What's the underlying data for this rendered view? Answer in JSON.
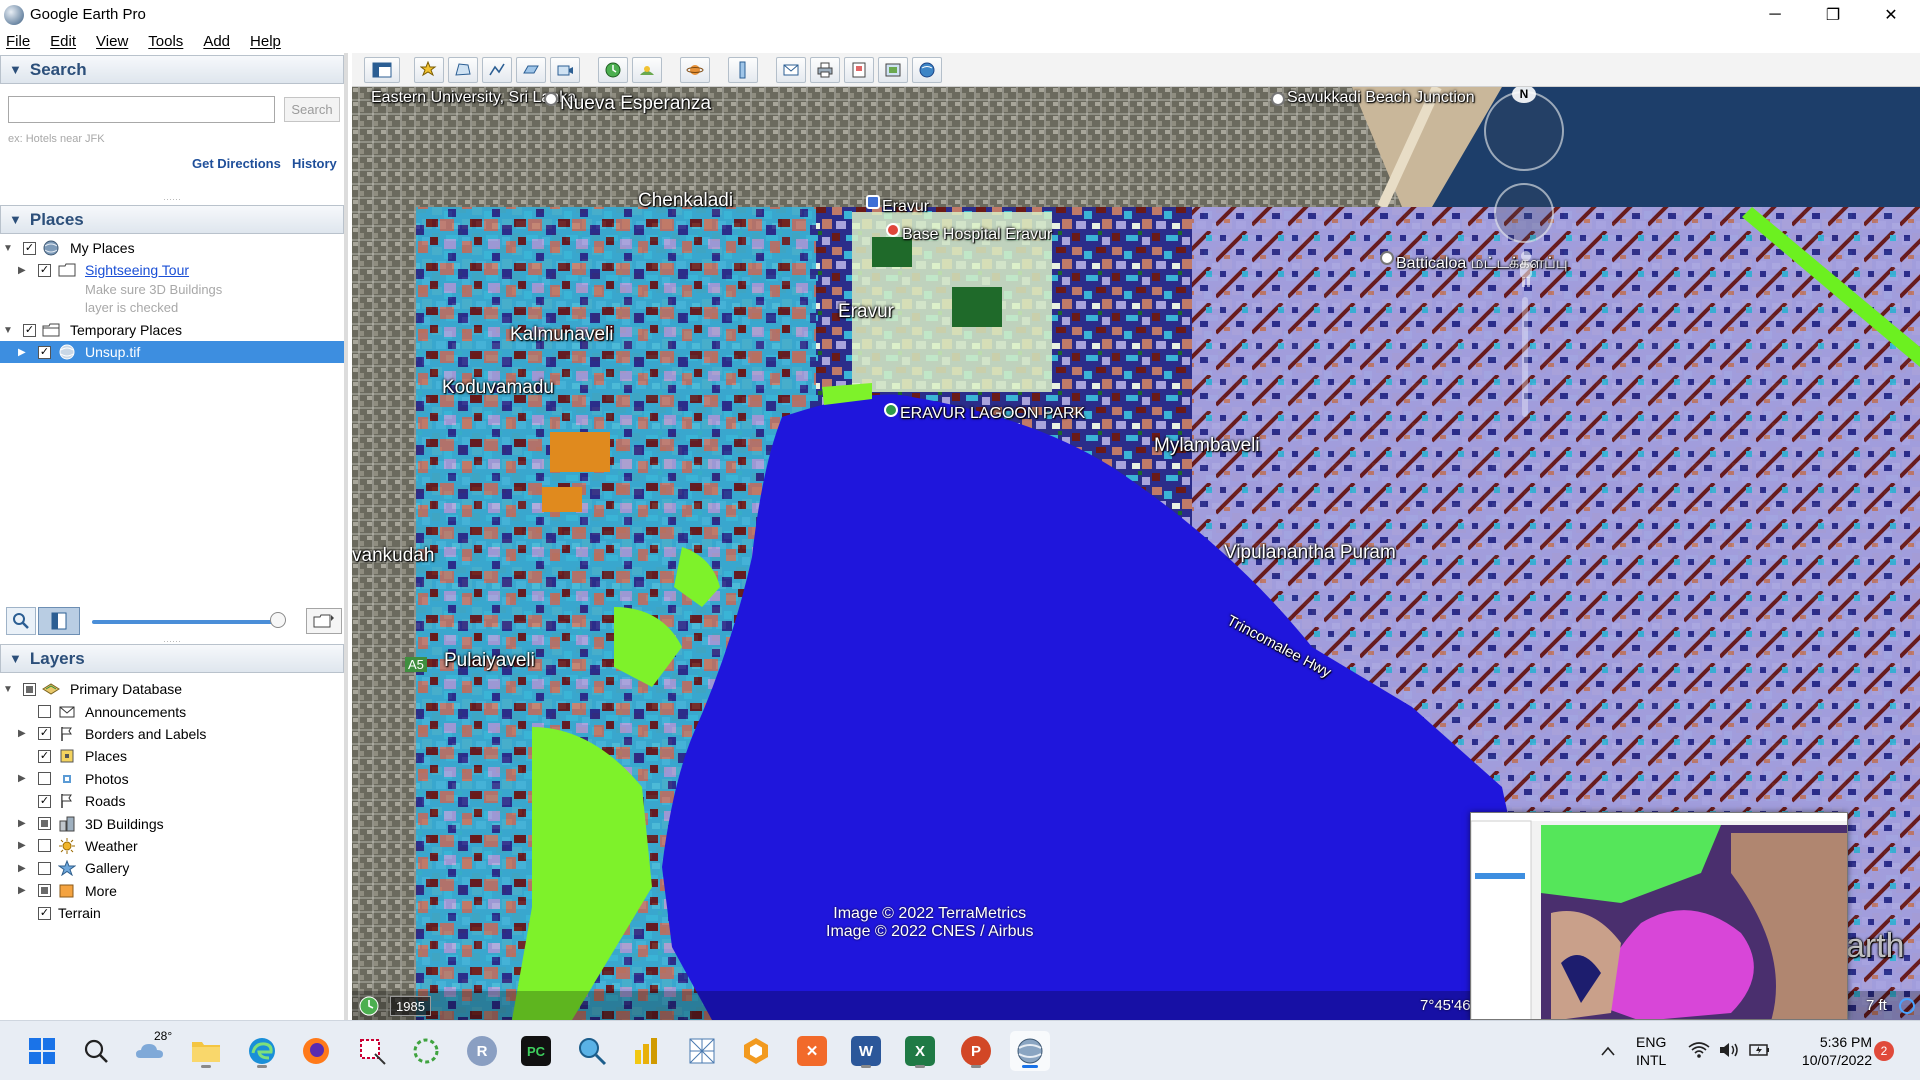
{
  "window": {
    "title": "Google Earth Pro",
    "minimize": "─",
    "restore": "❐",
    "close": "✕"
  },
  "menu": [
    "File",
    "Edit",
    "View",
    "Tools",
    "Add",
    "Help"
  ],
  "search": {
    "header": "Search",
    "placeholder": "",
    "button": "Search",
    "hint": "ex: Hotels near JFK",
    "get_directions": "Get Directions",
    "history": "History"
  },
  "places": {
    "header": "Places",
    "my_places": "My Places",
    "sightseeing": "Sightseeing Tour",
    "note_line1": "Make sure 3D Buildings",
    "note_line2": "layer is checked",
    "temporary": "Temporary Places",
    "unsup": "Unsup.tif"
  },
  "layers": {
    "header": "Layers",
    "items": [
      {
        "label": "Primary Database",
        "checked": "partial"
      },
      {
        "label": "Announcements",
        "checked": "no"
      },
      {
        "label": "Borders and Labels",
        "checked": "yes"
      },
      {
        "label": "Places",
        "checked": "yes"
      },
      {
        "label": "Photos",
        "checked": "no"
      },
      {
        "label": "Roads",
        "checked": "yes"
      },
      {
        "label": "3D Buildings",
        "checked": "partial"
      },
      {
        "label": "Weather",
        "checked": "no"
      },
      {
        "label": "Gallery",
        "checked": "no"
      },
      {
        "label": "More",
        "checked": "partial"
      },
      {
        "label": "Terrain",
        "checked": "yes"
      }
    ]
  },
  "map": {
    "labels": {
      "eastern_university": "Eastern University, Sri Lanka",
      "nueva_esperanza": "Nueva Esperanza",
      "savukkadi": "Savukkadi Beach Junction",
      "chenkaladi": "Chenkaladi",
      "eravur_top": "Eravur",
      "base_hospital": "Base Hospital Eravur",
      "batticaloa": "Batticaloa மட்டக்களப்பு",
      "kalmunaveli": "Kalmunaveli",
      "eravur": "Eravur",
      "koduvamadu": "Koduvamadu",
      "lagoon_park": "ERAVUR LAGOON PARK",
      "mylambaveli": "Mylambaveli",
      "vankudah": "vankudah",
      "a5": "A5",
      "vipulanantha": "Vipulanantha Puram",
      "trinco_hwy": "Trincomalee Hwy",
      "pulaiyaveli": "Pulaiyaveli",
      "earth_watermark": "arth"
    },
    "attribution_line1": "Image © 2022 TerraMetrics",
    "attribution_line2": "Image © 2022 CNES / Airbus",
    "year": "1985",
    "coords": "7°45'46",
    "eye_alt": "7 ft",
    "north": "N"
  },
  "taskbar": {
    "weather_temp": "28°",
    "lang_line1": "ENG",
    "lang_line2": "INTL",
    "time": "5:36 PM",
    "date": "10/07/2022",
    "notifications": "2"
  }
}
